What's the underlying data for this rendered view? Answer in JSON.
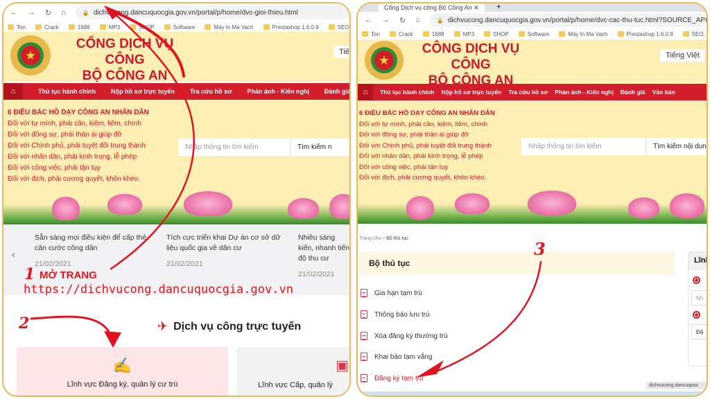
{
  "left": {
    "url": "dichvucong.dancuquocgia.gov.vn/portal/p/home/dvc-gioi-thieu.html",
    "bookmarks": [
      "Ton",
      "Crack",
      "1688",
      "MP3",
      "SHOP",
      "Software",
      "Máy In Ma Vach",
      "Prestashop 1.6.0.9",
      "SEO, Tang Range"
    ],
    "site_title_1": "CỔNG DỊCH VỤ CÔNG",
    "site_title_2": "BỘ CÔNG AN",
    "language": "Tiếng",
    "nav": [
      "Thủ tục hành chính",
      "Nộp hồ sơ trực tuyến",
      "Tra cứu hồ sơ",
      "Phản ánh - Kiến nghị",
      "Đánh giá"
    ],
    "rules_heading": "6 ĐIỀU BÁC HỒ DẠY CÔNG AN NHÂN DÂN",
    "rules": [
      "Đối với tự mình, phải cần, kiệm, liêm, chính",
      "Đối với đồng sự, phải thân ái giúp đỡ",
      "Đối với Chính phủ, phải tuyệt đối trung thành",
      "Đối với nhân dân, phải kính trọng, lễ phép",
      "Đối với công việc, phải tận tụy",
      "Đối với địch, phải cương quyết, khôn khéo."
    ],
    "search_placeholder": "Nhập thông tin tìm kiếm",
    "search_button": "Tìm kiếm n",
    "news": [
      {
        "title": "Sẵn sàng mọi điều kiện để cấp thẻ căn cước công dân",
        "date": "21/02/2021"
      },
      {
        "title": "Tích cực triển khai Dự án cơ sở dữ liệu quốc gia về dân cư",
        "date": "21/02/2021"
      },
      {
        "title": "Nhiều sáng kiến, nhanh tiến độ thu cư",
        "date": "21/02/2021"
      }
    ],
    "section_title": "Dịch vụ công trực tuyến",
    "cards": [
      "Lĩnh vực Đăng ký, quản lý cư trú",
      "Lĩnh vực Cấp, quản lý"
    ]
  },
  "right": {
    "tab_title": "Cổng Dịch vụ công Bộ Công An",
    "url": "dichvucong.dancuquocgia.gov.vn/portal/p/home/dvc-cac-thu-tuc.html?SOURCE_APP=DVCQLCT&csrt=...",
    "bookmarks": [
      "Ton",
      "Crack",
      "1688",
      "MP3",
      "SHOP",
      "Software",
      "Máy In Ma Vach",
      "Prestashop 1.6.0.9",
      "SEO, Tang Range"
    ],
    "site_title_1": "CÔNG DỊCH VỤ CÔNG",
    "site_title_2": "BỘ CÔNG AN",
    "language": "Tiếng Việt",
    "nav": [
      "Thủ tục hành chính",
      "Nộp hồ sơ trực tuyến",
      "Tra cứu hồ sơ",
      "Phản ánh - Kiến nghị",
      "Đánh giá",
      "Văn bản"
    ],
    "rules_heading": "6 ĐIỀU BÁC HỒ DẠY CÔNG AN NHÂN DÂN",
    "rules": [
      "Đối với tự mình, phải cần, kiệm, liêm, chính",
      "Đối với đồng sự, phải thân ái giúp đỡ",
      "Đối với Chính phủ, phải tuyệt đối trung thành",
      "Đối với nhân dân, phải kính trọng, lễ phép",
      "Đối với công việc, phải tận tụy",
      "Đối với địch, phải cương quyết, khôn khéo."
    ],
    "search_placeholder": "Nhập thông tin tìm kiếm",
    "search_button": "Tìm kiếm nội dung",
    "breadcrumb": [
      "Trang chủ",
      "Bộ thủ tục"
    ],
    "procedures_title": "Bộ thủ tục",
    "procedures": [
      "Gia hạn tạm trú",
      "Thông báo lưu trú",
      "Xóa đăng ký thường trú",
      "Khai báo tạm vắng",
      "Đăng ký tạm trú"
    ],
    "side_title": "Lĩnh",
    "side_input": "Nh",
    "side_select": "Đă",
    "status_url": "dichvucong.dancuquoc"
  },
  "annotations": {
    "step1_number": "1",
    "step1_label": "MỞ TRANG",
    "step1_url": "https://dichvucong.dancuquocgia.gov.vn",
    "step2_number": "2",
    "step3_number": "3"
  },
  "colors": {
    "brand_red": "#d21d2c",
    "header_yellow": "#fdeeb3",
    "annotation_red": "#e0141e",
    "frame_gold": "#e7b95c"
  }
}
